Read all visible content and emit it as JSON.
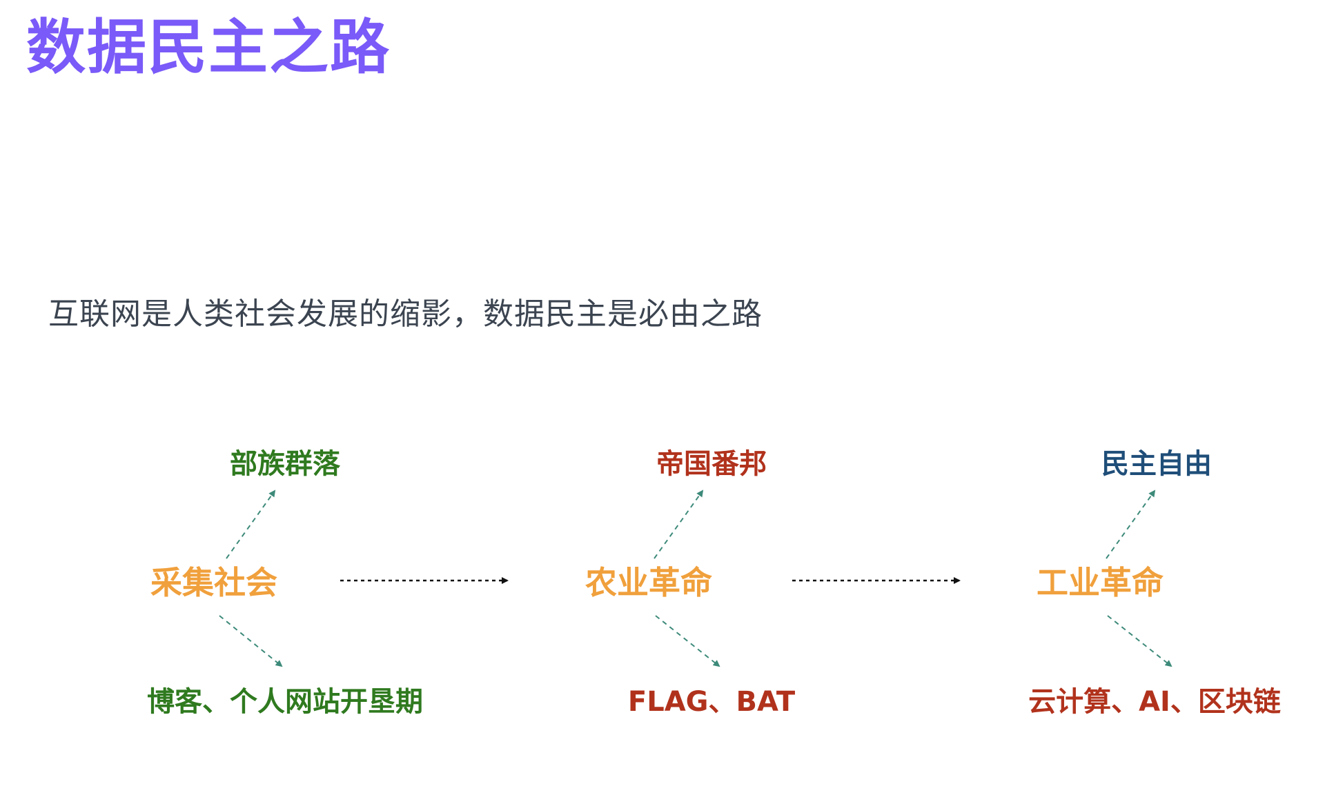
{
  "title": "数据民主之路",
  "subtitle": "互联网是人类社会发展的缩影，数据民主是必由之路",
  "colors": {
    "title": "#7a5af8",
    "subtitle": "#3b4450",
    "stage": "#f0a03c",
    "branch_arrow": "#3d8a7a",
    "main_arrow": "#111111"
  },
  "columns": [
    {
      "stage": "采集社会",
      "upper": {
        "text": "部族群落",
        "color": "#2f7a1f"
      },
      "lower": {
        "text": "博客、个人网站开垦期",
        "color": "#2f7a1f"
      }
    },
    {
      "stage": "农业革命",
      "upper": {
        "text": "帝国番邦",
        "color": "#b1321c"
      },
      "lower": {
        "text": "FLAG、BAT",
        "color": "#b1321c"
      }
    },
    {
      "stage": "工业革命",
      "upper": {
        "text": "民主自由",
        "color": "#1f4e79"
      },
      "lower": {
        "text": "云计算、AI、区块链",
        "color": "#b1321c"
      }
    }
  ]
}
